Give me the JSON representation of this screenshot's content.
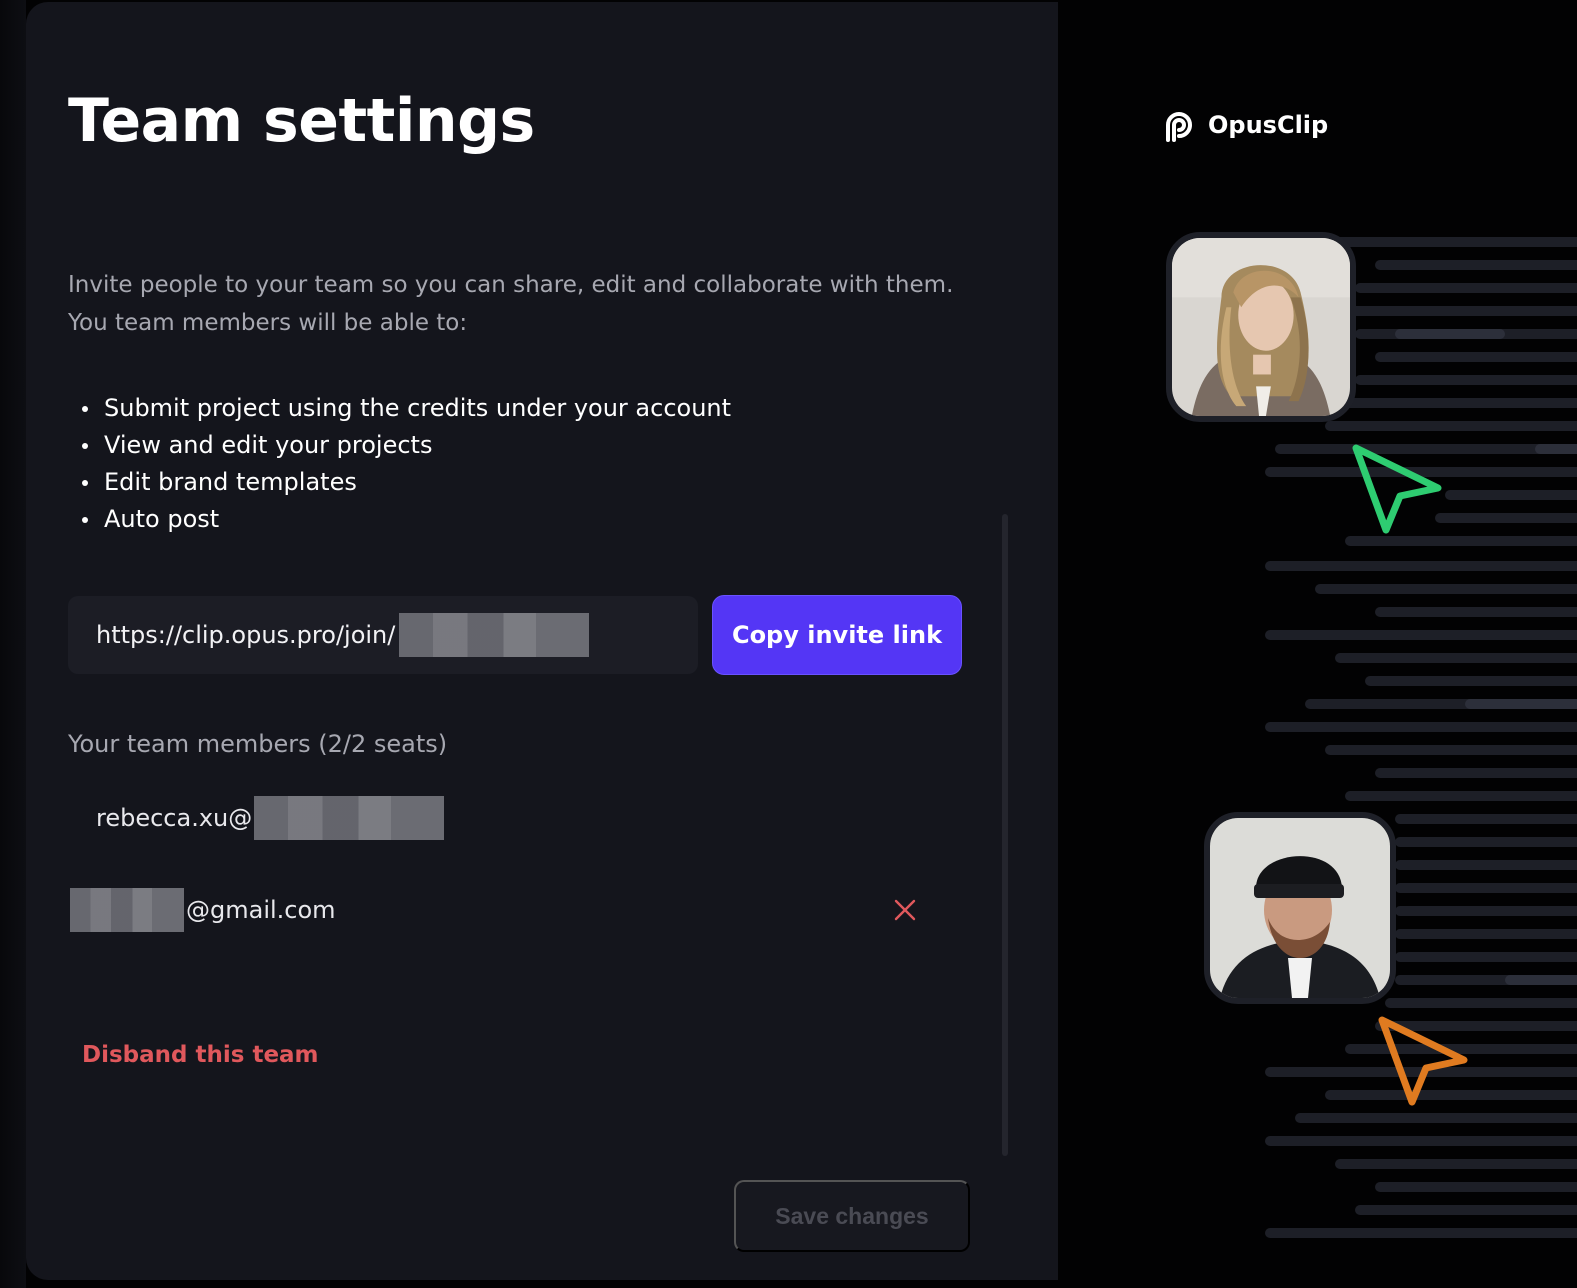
{
  "modal": {
    "title": "Team settings",
    "intro": "Invite people to your team so you can share, edit and collaborate with them. You team members will be able to:",
    "permissions": [
      "Submit project using the credits under your account",
      "View and edit your projects",
      "Edit brand templates",
      "Auto post"
    ],
    "invite_link_prefix": "https://clip.opus.pro/join/",
    "copy_button_label": "Copy invite link",
    "members_heading": "Your team members (2/2 seats)",
    "members": [
      {
        "visible_text": "rebecca.xu@",
        "redacted": "domain"
      },
      {
        "visible_text": "@gmail.com",
        "redacted": "username",
        "removable": true
      }
    ],
    "disband_label": "Disband this team",
    "save_button_label": "Save changes"
  },
  "brand": {
    "name": "OpusClip",
    "icon": "opusclip-logo-icon"
  },
  "decor": {
    "avatars": [
      "woman-avatar",
      "man-beanie-avatar"
    ],
    "cursors": [
      {
        "icon": "cursor-arrow-icon",
        "color": "#2ecc71"
      },
      {
        "icon": "cursor-arrow-icon",
        "color": "#e07b20"
      }
    ]
  },
  "colors": {
    "panel_bg": "#14151c",
    "accent": "#5436f5",
    "danger": "#e0585c",
    "muted_text": "#a7a8b1"
  }
}
